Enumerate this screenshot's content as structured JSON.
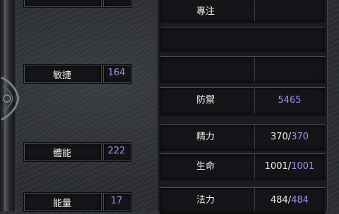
{
  "left_stats": [
    {
      "label": "敏捷",
      "value": "164"
    },
    {
      "label": "體能",
      "value": "222"
    },
    {
      "label": "能量",
      "value": "17"
    }
  ],
  "right_stats": {
    "focus": {
      "label": "專注"
    },
    "defense": {
      "label": "防禦",
      "value": "5465"
    },
    "stamina": {
      "label": "精力",
      "current": "370",
      "sep": "/",
      "max": "370"
    },
    "life": {
      "label": "生命",
      "current": "1001",
      "sep": "/",
      "max": "1001"
    },
    "mana": {
      "label": "法力",
      "current": "484",
      "sep": "/",
      "max": "484"
    }
  }
}
